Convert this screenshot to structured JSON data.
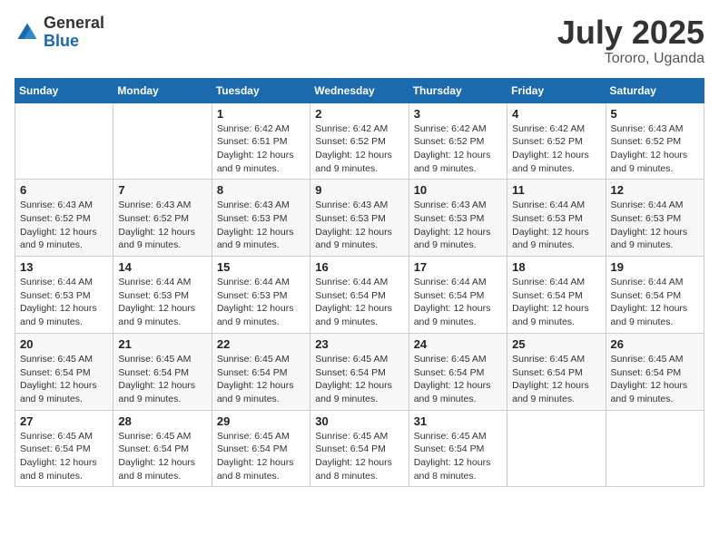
{
  "logo": {
    "general": "General",
    "blue": "Blue"
  },
  "title": "July 2025",
  "subtitle": "Tororo, Uganda",
  "days_header": [
    "Sunday",
    "Monday",
    "Tuesday",
    "Wednesday",
    "Thursday",
    "Friday",
    "Saturday"
  ],
  "weeks": [
    [
      {
        "num": "",
        "info": ""
      },
      {
        "num": "",
        "info": ""
      },
      {
        "num": "1",
        "info": "Sunrise: 6:42 AM\nSunset: 6:51 PM\nDaylight: 12 hours and 9 minutes."
      },
      {
        "num": "2",
        "info": "Sunrise: 6:42 AM\nSunset: 6:52 PM\nDaylight: 12 hours and 9 minutes."
      },
      {
        "num": "3",
        "info": "Sunrise: 6:42 AM\nSunset: 6:52 PM\nDaylight: 12 hours and 9 minutes."
      },
      {
        "num": "4",
        "info": "Sunrise: 6:42 AM\nSunset: 6:52 PM\nDaylight: 12 hours and 9 minutes."
      },
      {
        "num": "5",
        "info": "Sunrise: 6:43 AM\nSunset: 6:52 PM\nDaylight: 12 hours and 9 minutes."
      }
    ],
    [
      {
        "num": "6",
        "info": "Sunrise: 6:43 AM\nSunset: 6:52 PM\nDaylight: 12 hours and 9 minutes."
      },
      {
        "num": "7",
        "info": "Sunrise: 6:43 AM\nSunset: 6:52 PM\nDaylight: 12 hours and 9 minutes."
      },
      {
        "num": "8",
        "info": "Sunrise: 6:43 AM\nSunset: 6:53 PM\nDaylight: 12 hours and 9 minutes."
      },
      {
        "num": "9",
        "info": "Sunrise: 6:43 AM\nSunset: 6:53 PM\nDaylight: 12 hours and 9 minutes."
      },
      {
        "num": "10",
        "info": "Sunrise: 6:43 AM\nSunset: 6:53 PM\nDaylight: 12 hours and 9 minutes."
      },
      {
        "num": "11",
        "info": "Sunrise: 6:44 AM\nSunset: 6:53 PM\nDaylight: 12 hours and 9 minutes."
      },
      {
        "num": "12",
        "info": "Sunrise: 6:44 AM\nSunset: 6:53 PM\nDaylight: 12 hours and 9 minutes."
      }
    ],
    [
      {
        "num": "13",
        "info": "Sunrise: 6:44 AM\nSunset: 6:53 PM\nDaylight: 12 hours and 9 minutes."
      },
      {
        "num": "14",
        "info": "Sunrise: 6:44 AM\nSunset: 6:53 PM\nDaylight: 12 hours and 9 minutes."
      },
      {
        "num": "15",
        "info": "Sunrise: 6:44 AM\nSunset: 6:53 PM\nDaylight: 12 hours and 9 minutes."
      },
      {
        "num": "16",
        "info": "Sunrise: 6:44 AM\nSunset: 6:54 PM\nDaylight: 12 hours and 9 minutes."
      },
      {
        "num": "17",
        "info": "Sunrise: 6:44 AM\nSunset: 6:54 PM\nDaylight: 12 hours and 9 minutes."
      },
      {
        "num": "18",
        "info": "Sunrise: 6:44 AM\nSunset: 6:54 PM\nDaylight: 12 hours and 9 minutes."
      },
      {
        "num": "19",
        "info": "Sunrise: 6:44 AM\nSunset: 6:54 PM\nDaylight: 12 hours and 9 minutes."
      }
    ],
    [
      {
        "num": "20",
        "info": "Sunrise: 6:45 AM\nSunset: 6:54 PM\nDaylight: 12 hours and 9 minutes."
      },
      {
        "num": "21",
        "info": "Sunrise: 6:45 AM\nSunset: 6:54 PM\nDaylight: 12 hours and 9 minutes."
      },
      {
        "num": "22",
        "info": "Sunrise: 6:45 AM\nSunset: 6:54 PM\nDaylight: 12 hours and 9 minutes."
      },
      {
        "num": "23",
        "info": "Sunrise: 6:45 AM\nSunset: 6:54 PM\nDaylight: 12 hours and 9 minutes."
      },
      {
        "num": "24",
        "info": "Sunrise: 6:45 AM\nSunset: 6:54 PM\nDaylight: 12 hours and 9 minutes."
      },
      {
        "num": "25",
        "info": "Sunrise: 6:45 AM\nSunset: 6:54 PM\nDaylight: 12 hours and 9 minutes."
      },
      {
        "num": "26",
        "info": "Sunrise: 6:45 AM\nSunset: 6:54 PM\nDaylight: 12 hours and 9 minutes."
      }
    ],
    [
      {
        "num": "27",
        "info": "Sunrise: 6:45 AM\nSunset: 6:54 PM\nDaylight: 12 hours and 8 minutes."
      },
      {
        "num": "28",
        "info": "Sunrise: 6:45 AM\nSunset: 6:54 PM\nDaylight: 12 hours and 8 minutes."
      },
      {
        "num": "29",
        "info": "Sunrise: 6:45 AM\nSunset: 6:54 PM\nDaylight: 12 hours and 8 minutes."
      },
      {
        "num": "30",
        "info": "Sunrise: 6:45 AM\nSunset: 6:54 PM\nDaylight: 12 hours and 8 minutes."
      },
      {
        "num": "31",
        "info": "Sunrise: 6:45 AM\nSunset: 6:54 PM\nDaylight: 12 hours and 8 minutes."
      },
      {
        "num": "",
        "info": ""
      },
      {
        "num": "",
        "info": ""
      }
    ]
  ]
}
